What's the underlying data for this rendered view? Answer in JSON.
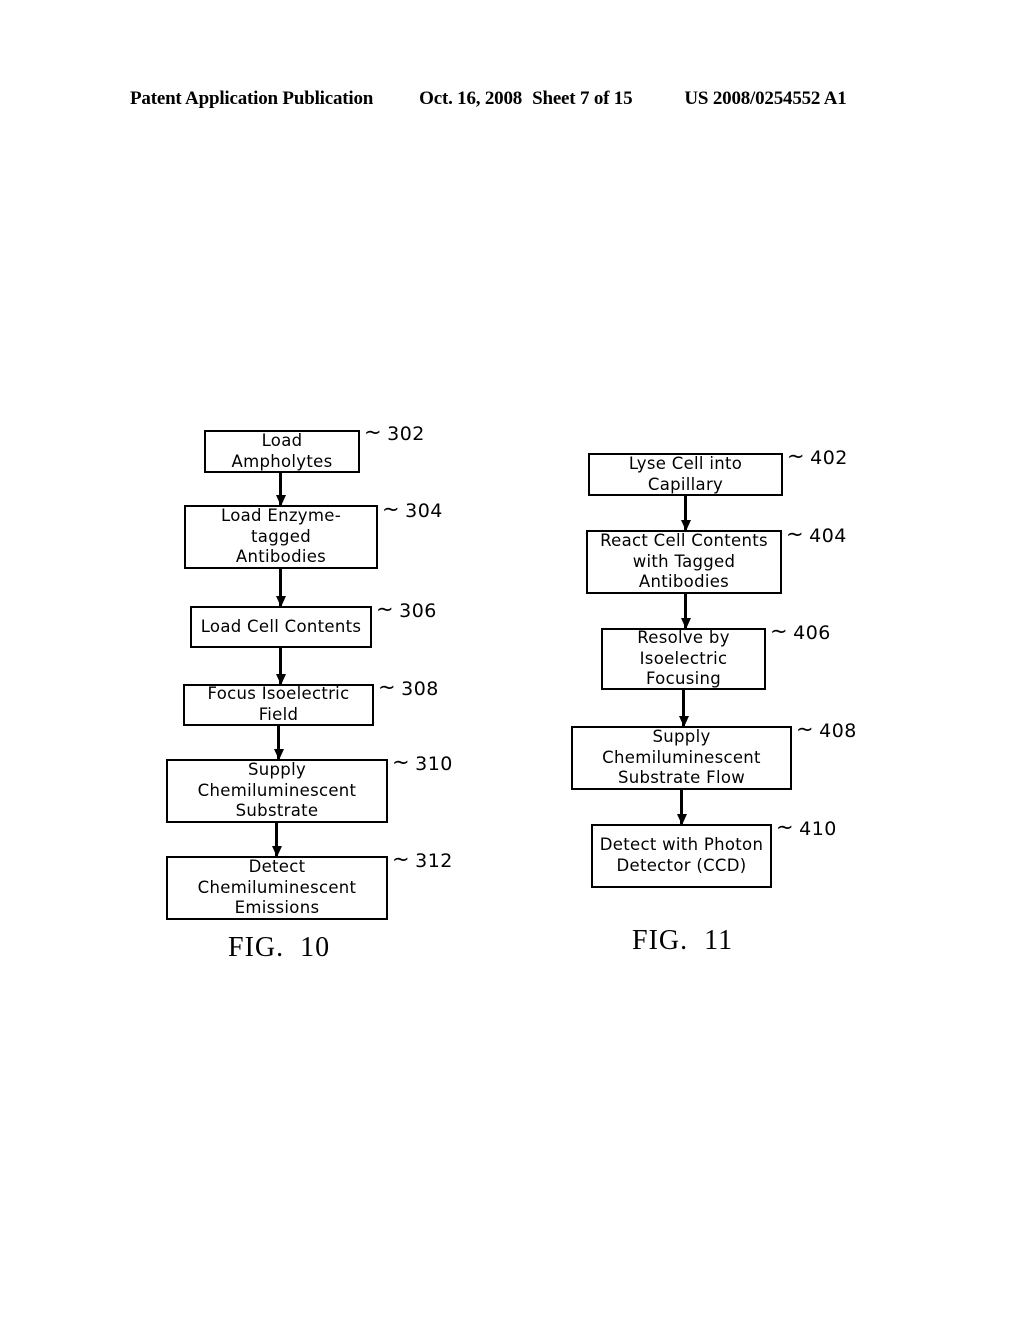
{
  "header": {
    "left": "Patent Application Publication",
    "date": "Oct. 16, 2008",
    "sheet": "Sheet 7 of 15",
    "patent_number": "US 2008/0254552 A1"
  },
  "figures": [
    {
      "id": "fig10",
      "caption": "FIG.  10",
      "steps": [
        {
          "ref": "302",
          "text": "Load Ampholytes"
        },
        {
          "ref": "304",
          "text": "Load Enzyme-tagged\nAntibodies"
        },
        {
          "ref": "306",
          "text": "Load Cell Contents"
        },
        {
          "ref": "308",
          "text": "Focus Isoelectric Field"
        },
        {
          "ref": "310",
          "text": "Supply Chemiluminescent\nSubstrate"
        },
        {
          "ref": "312",
          "text": "Detect Chemiluminescent\nEmissions"
        }
      ]
    },
    {
      "id": "fig11",
      "caption": "FIG.  11",
      "steps": [
        {
          "ref": "402",
          "text": "Lyse Cell into Capillary"
        },
        {
          "ref": "404",
          "text": "React Cell Contents\nwith Tagged Antibodies"
        },
        {
          "ref": "406",
          "text": "Resolve by\nIsoelectric Focusing"
        },
        {
          "ref": "408",
          "text": "Supply Chemiluminescent\nSubstrate Flow"
        },
        {
          "ref": "410",
          "text": "Detect with Photon\nDetector (CCD)"
        }
      ]
    }
  ],
  "leader_glyph": "~",
  "colors": {
    "ink": "#000000",
    "paper": "#ffffff"
  }
}
